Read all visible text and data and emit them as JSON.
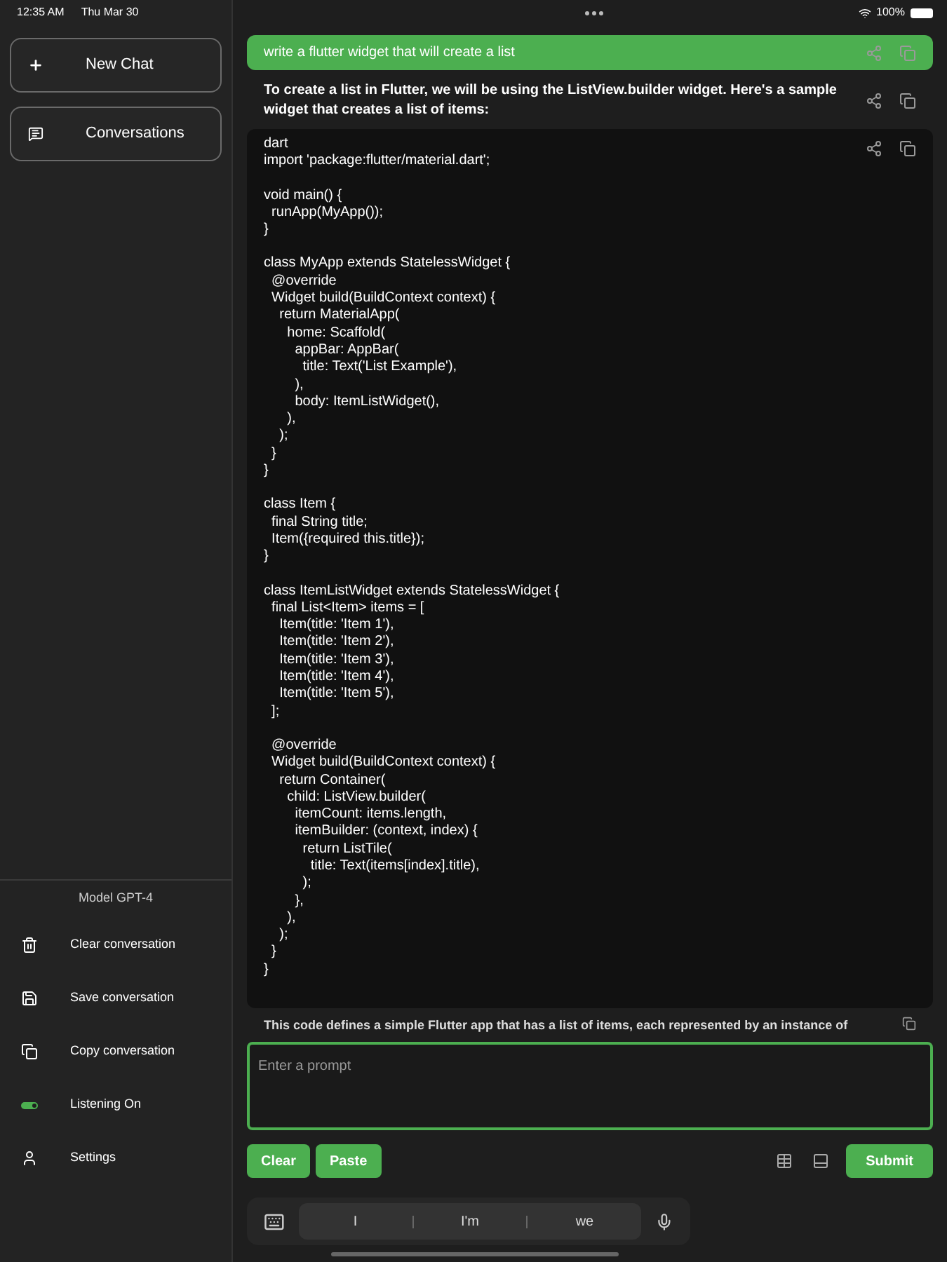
{
  "status_bar": {
    "time": "12:35 AM",
    "date": "Thu Mar 30",
    "battery": "100%"
  },
  "sidebar": {
    "buttons": [
      {
        "label": "New Chat",
        "kind": "new"
      },
      {
        "label": "Conversations",
        "kind": "conversations"
      }
    ],
    "model": "Model GPT-4",
    "items": [
      {
        "label": "Clear conversation",
        "kind": "clear"
      },
      {
        "label": "Save conversation",
        "kind": "save"
      },
      {
        "label": "Copy conversation",
        "kind": "copy"
      },
      {
        "label": "Listening On",
        "kind": "toggle",
        "on": true
      },
      {
        "label": "Settings",
        "kind": "settings"
      }
    ]
  },
  "chat": {
    "user_message": "write a flutter widget that will create a list",
    "response_intro": "To create a list in Flutter, we will be using the ListView.builder widget. Here's a sample widget that creates a list of items:",
    "code": {
      "language": "dart",
      "blocks": [
        [
          "import 'package:flutter/material.dart';"
        ],
        [
          "void main() {",
          "  runApp(MyApp());",
          "}"
        ],
        [
          "class MyApp extends StatelessWidget {",
          "  @override",
          "  Widget build(BuildContext context) {",
          "    return MaterialApp(",
          "      home: Scaffold(",
          "        appBar: AppBar(",
          "          title: Text('List Example'),",
          "        ),",
          "        body: ItemListWidget(),",
          "      ),",
          "    );",
          "  }",
          "}"
        ],
        [
          "class Item {",
          "  final String title;",
          "  Item({required this.title});",
          "}"
        ],
        [
          "class ItemListWidget extends StatelessWidget {",
          "  final List<Item> items = [",
          "    Item(title: 'Item 1'),",
          "    Item(title: 'Item 2'),",
          "    Item(title: 'Item 3'),",
          "    Item(title: 'Item 4'),",
          "    Item(title: 'Item 5'),",
          "  ];"
        ],
        [
          "  @override",
          "  Widget build(BuildContext context) {",
          "    return Container(",
          "      child: ListView.builder(",
          "        itemCount: items.length,",
          "        itemBuilder: (context, index) {",
          "          return ListTile(",
          "            title: Text(items[index].title),",
          "          );",
          "        },",
          "      ),",
          "    );",
          "  }",
          "}"
        ]
      ]
    },
    "response_outro": "This code defines a simple Flutter app that has a list of items, each represented by an instance of"
  },
  "prompt": {
    "placeholder": "Enter a prompt"
  },
  "actions": {
    "left": [
      "Clear",
      "Paste"
    ],
    "submit": "Submit"
  },
  "keyboard": {
    "suggestions": [
      "I",
      "I'm",
      "we"
    ]
  }
}
